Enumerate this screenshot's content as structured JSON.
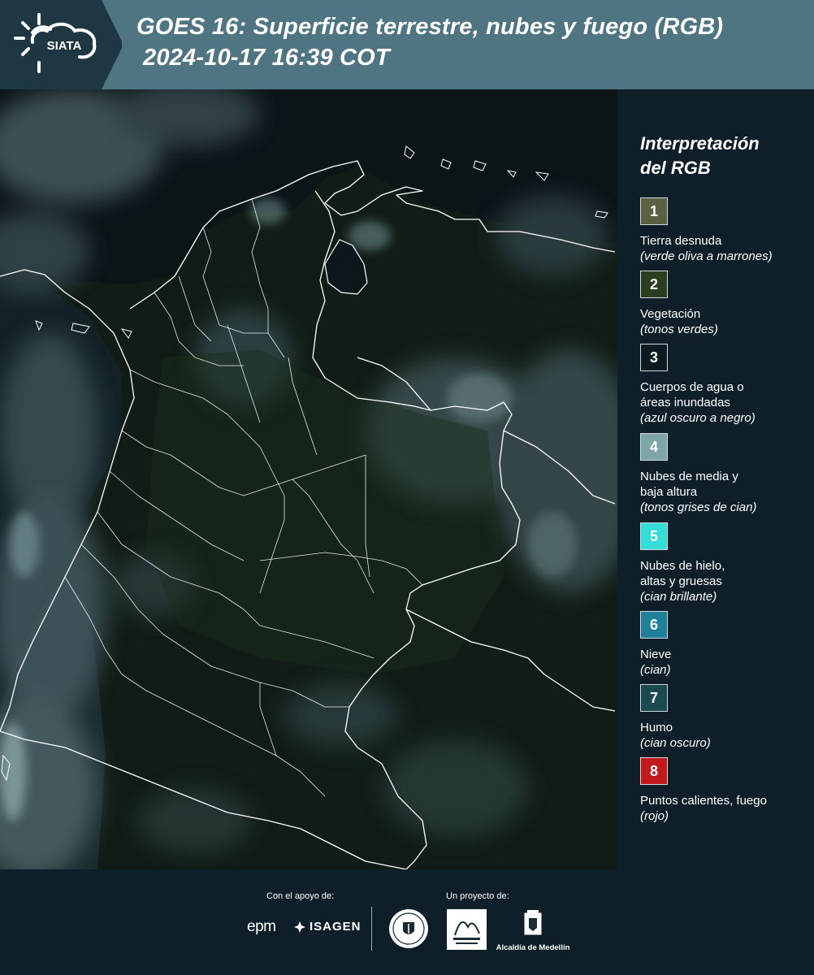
{
  "header": {
    "logo_text": "SIATA",
    "title_line1": "GOES 16: Superficie terrestre, nubes y fuego (RGB)",
    "title_line2": "2024-10-17 16:39 COT",
    "background": "#4f7582",
    "logo_background": "#1f3743"
  },
  "map": {
    "base_color": "#101c15",
    "border_color": "#ffffff"
  },
  "legend": {
    "title_line1": "Interpretación",
    "title_line2": "del RGB",
    "items": [
      {
        "number": "1",
        "color": "#5d5f42",
        "lines": [
          "Tierra desnuda"
        ],
        "note": "(verde oliva a marrones)"
      },
      {
        "number": "2",
        "color": "#2b3e20",
        "lines": [
          "Vegetación"
        ],
        "note": "(tonos verdes)"
      },
      {
        "number": "3",
        "color": "#0c1a22",
        "lines": [
          "Cuerpos de agua o",
          "áreas inundadas"
        ],
        "note": "(azul oscuro a negro)"
      },
      {
        "number": "4",
        "color": "#7fa6a6",
        "lines": [
          "Nubes de media y",
          "baja altura"
        ],
        "note": "(tonos grises de cian)"
      },
      {
        "number": "5",
        "color": "#35ddd9",
        "lines": [
          "Nubes de hielo,",
          "altas y gruesas"
        ],
        "note": "(cian brillante)"
      },
      {
        "number": "6",
        "color": "#20809a",
        "lines": [
          "Nieve"
        ],
        "note": "(cian)"
      },
      {
        "number": "7",
        "color": "#1a4a4e",
        "lines": [
          "Humo"
        ],
        "note": "(cian oscuro)"
      },
      {
        "number": "8",
        "color": "#c4191c",
        "lines": [
          "Puntos calientes, fuego"
        ],
        "note": "(rojo)"
      }
    ]
  },
  "footer": {
    "support_caption": "Con el apoyo de:",
    "project_caption": "Un proyecto de:",
    "epm_logo": "epm",
    "isagen_logo": "ISAGEN",
    "alcaldia_label": "Alcaldía de Medellín"
  }
}
